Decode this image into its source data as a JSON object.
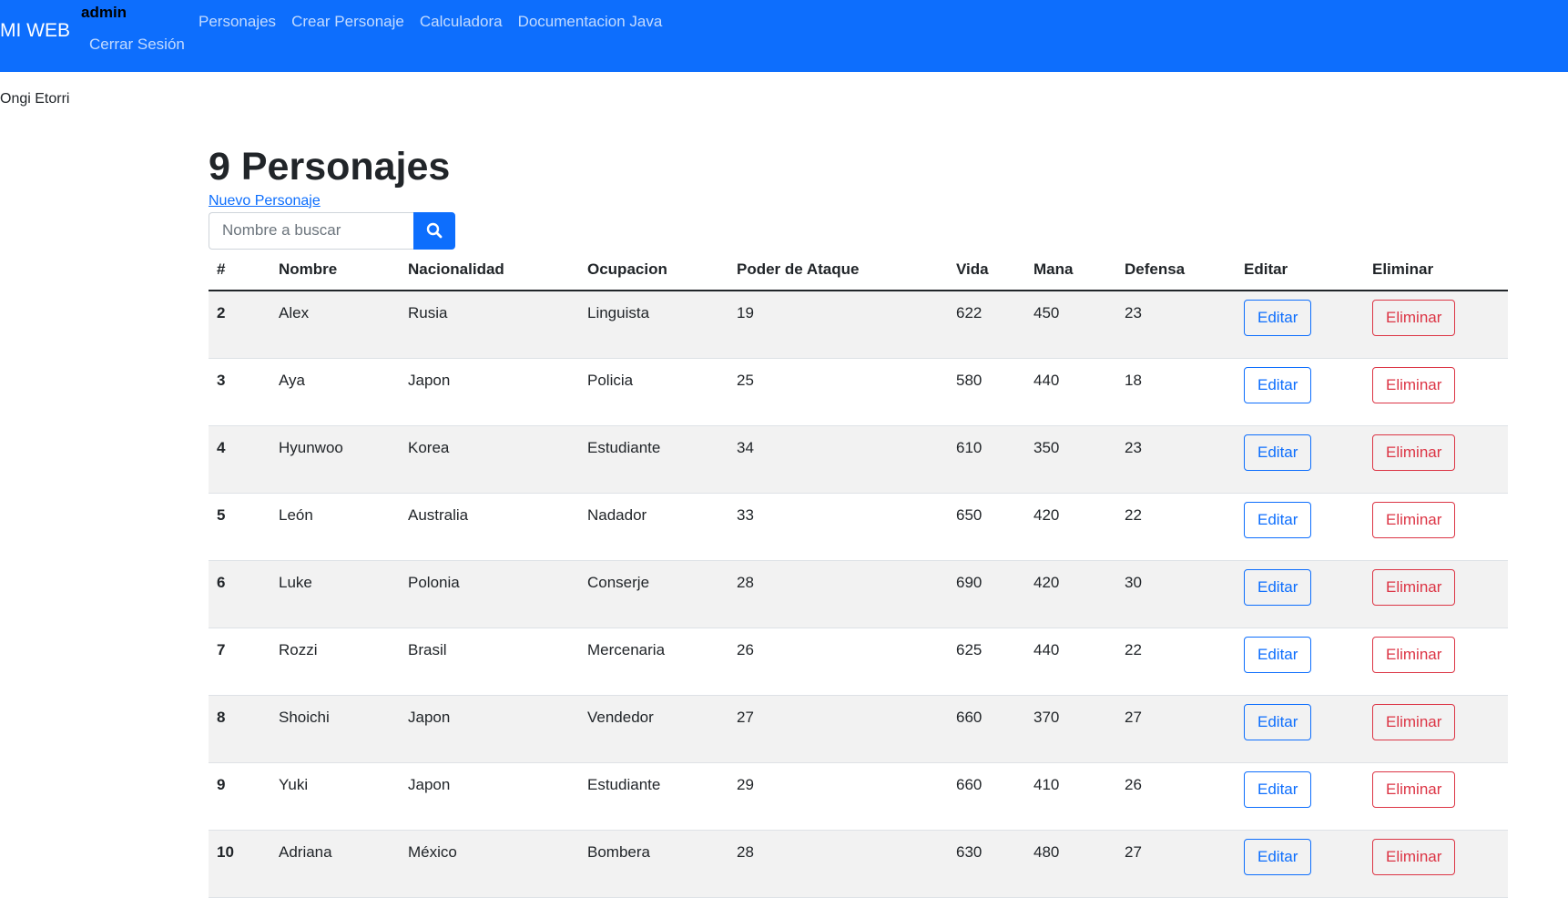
{
  "navbar": {
    "brand": "MI WEB",
    "user": "admin",
    "logout": "Cerrar Sesión",
    "links": [
      "Personajes",
      "Crear Personaje",
      "Calculadora",
      "Documentacion Java"
    ],
    "color": "#0d6efd"
  },
  "footer_text": "Ongi Etorri",
  "main": {
    "title": "9 Personajes",
    "new_link": "Nuevo Personaje",
    "search": {
      "placeholder": "Nombre a buscar",
      "value": "",
      "icon": "search-icon"
    }
  },
  "table": {
    "headers": [
      "#",
      "Nombre",
      "Nacionalidad",
      "Ocupacion",
      "Poder de Ataque",
      "Vida",
      "Mana",
      "Defensa",
      "Editar",
      "Eliminar"
    ],
    "rows": [
      {
        "id": "2",
        "nombre": "Alex",
        "nacionalidad": "Rusia",
        "ocupacion": "Linguista",
        "ataque": "19",
        "vida": "622",
        "mana": "450",
        "defensa": "23",
        "editar": "Editar",
        "eliminar": "Eliminar"
      },
      {
        "id": "3",
        "nombre": "Aya",
        "nacionalidad": "Japon",
        "ocupacion": "Policia",
        "ataque": "25",
        "vida": "580",
        "mana": "440",
        "defensa": "18",
        "editar": "Editar",
        "eliminar": "Eliminar"
      },
      {
        "id": "4",
        "nombre": "Hyunwoo",
        "nacionalidad": "Korea",
        "ocupacion": "Estudiante",
        "ataque": "34",
        "vida": "610",
        "mana": "350",
        "defensa": "23",
        "editar": "Editar",
        "eliminar": "Eliminar"
      },
      {
        "id": "5",
        "nombre": "León",
        "nacionalidad": "Australia",
        "ocupacion": "Nadador",
        "ataque": "33",
        "vida": "650",
        "mana": "420",
        "defensa": "22",
        "editar": "Editar",
        "eliminar": "Eliminar"
      },
      {
        "id": "6",
        "nombre": "Luke",
        "nacionalidad": "Polonia",
        "ocupacion": "Conserje",
        "ataque": "28",
        "vida": "690",
        "mana": "420",
        "defensa": "30",
        "editar": "Editar",
        "eliminar": "Eliminar"
      },
      {
        "id": "7",
        "nombre": "Rozzi",
        "nacionalidad": "Brasil",
        "ocupacion": "Mercenaria",
        "ataque": "26",
        "vida": "625",
        "mana": "440",
        "defensa": "22",
        "editar": "Editar",
        "eliminar": "Eliminar"
      },
      {
        "id": "8",
        "nombre": "Shoichi",
        "nacionalidad": "Japon",
        "ocupacion": "Vendedor",
        "ataque": "27",
        "vida": "660",
        "mana": "370",
        "defensa": "27",
        "editar": "Editar",
        "eliminar": "Eliminar"
      },
      {
        "id": "9",
        "nombre": "Yuki",
        "nacionalidad": "Japon",
        "ocupacion": "Estudiante",
        "ataque": "29",
        "vida": "660",
        "mana": "410",
        "defensa": "26",
        "editar": "Editar",
        "eliminar": "Eliminar"
      },
      {
        "id": "10",
        "nombre": "Adriana",
        "nacionalidad": "México",
        "ocupacion": "Bombera",
        "ataque": "28",
        "vida": "630",
        "mana": "480",
        "defensa": "27",
        "editar": "Editar",
        "eliminar": "Eliminar"
      }
    ]
  }
}
